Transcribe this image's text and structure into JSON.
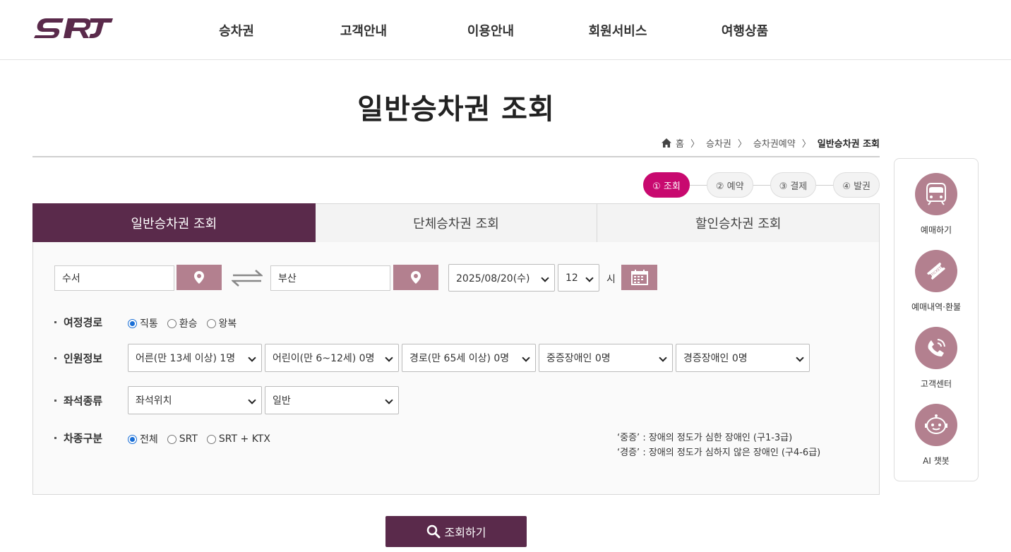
{
  "header": {
    "logo": "SRT",
    "nav": [
      "승차권",
      "고객안내",
      "이용안내",
      "회원서비스",
      "여행상품"
    ]
  },
  "page": {
    "title": "일반승차권 조회",
    "breadcrumb": [
      "홈",
      "승차권",
      "승차권예약",
      "일반승차권 조회"
    ]
  },
  "steps": [
    "① 조회",
    "② 예약",
    "③ 결제",
    "④ 발권"
  ],
  "tabs": [
    "일반승차권 조회",
    "단체승차권 조회",
    "할인승차권 조회"
  ],
  "form": {
    "departure": "수서",
    "arrival": "부산",
    "date": "2025/08/20(수)",
    "hour": "12",
    "hour_unit": "시",
    "route": {
      "label": "여정경로",
      "options": [
        "직통",
        "환승",
        "왕복"
      ],
      "selected": "직통"
    },
    "passengers": {
      "label": "인원정보",
      "selects": [
        "어른(만 13세 이상) 1명",
        "어린이(만 6~12세) 0명",
        "경로(만 65세 이상) 0명",
        "중증장애인 0명",
        "경증장애인 0명"
      ]
    },
    "seat": {
      "label": "좌석종류",
      "selects": [
        "좌석위치",
        "일반"
      ]
    },
    "train_type": {
      "label": "차종구분",
      "options": [
        "전체",
        "SRT",
        "SRT + KTX"
      ],
      "selected": "전체"
    },
    "notes": [
      "‘중증’ : 장애의 정도가 심한 장애인 (구1-3급)",
      "‘경증’ : 장애의 정도가 심하지 않은 장애인 (구4-6급)"
    ],
    "submit": "조회하기"
  },
  "quick_menu": [
    {
      "label": "예매하기",
      "icon": "train-icon"
    },
    {
      "label": "예매내역·환불",
      "icon": "ticket-icon"
    },
    {
      "label": "고객센터",
      "icon": "phone-icon"
    },
    {
      "label": "AI 챗봇",
      "icon": "chatbot-icon"
    }
  ],
  "colors": {
    "brand": "#5a2a4b",
    "accent": "#c8096f",
    "pin": "#b3808f"
  }
}
